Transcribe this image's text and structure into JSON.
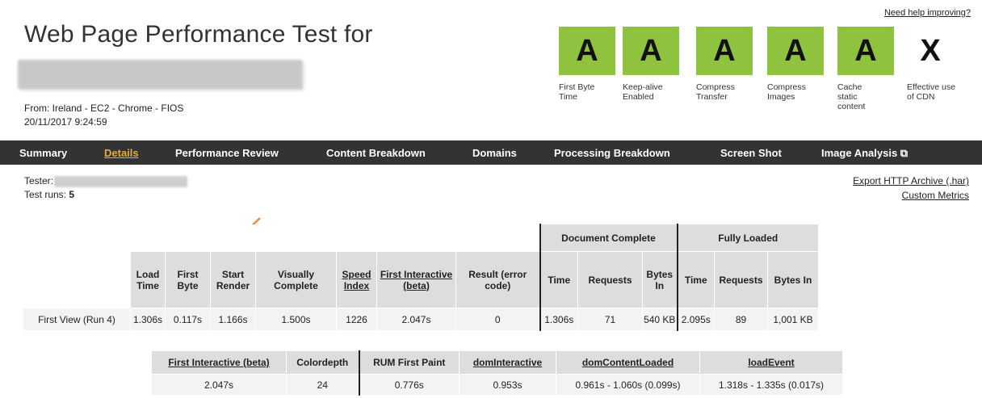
{
  "header": {
    "title": "Web Page Performance Test for",
    "from": "From: Ireland - EC2 - Chrome - FIOS",
    "date": "20/11/2017 9:24:59",
    "help_link": "Need help improving?"
  },
  "grades": [
    {
      "grade": "A",
      "label": "First Byte Time"
    },
    {
      "grade": "A",
      "label": "Keep-alive Enabled"
    },
    {
      "grade": "A",
      "label": "Compress Transfer"
    },
    {
      "grade": "A",
      "label": "Compress Images"
    },
    {
      "grade": "A",
      "label": "Cache static content"
    },
    {
      "grade": "X",
      "label": "Effective use of CDN"
    }
  ],
  "nav": {
    "items": [
      "Summary",
      "Details",
      "Performance Review",
      "Content Breakdown",
      "Domains",
      "Processing Breakdown",
      "Screen Shot",
      "Image Analysis ⧉"
    ],
    "active": "Details"
  },
  "info": {
    "tester_label": "Tester:",
    "runs_label": "Test runs:",
    "runs_value": "5",
    "export_link": "Export HTTP Archive (.har)",
    "custom_metrics_link": "Custom Metrics"
  },
  "results": {
    "group_doc": "Document Complete",
    "group_full": "Fully Loaded",
    "headers": [
      "Load Time",
      "First Byte",
      "Start Render",
      "Visually Complete",
      "Speed Index",
      "First Interactive (beta)",
      "Result (error code)",
      "Time",
      "Requests",
      "Bytes In",
      "Time",
      "Requests",
      "Bytes In"
    ],
    "row_label": "First View (",
    "row_link": "Run 4",
    "row_label_end": ")",
    "row": [
      "1.306s",
      "0.117s",
      "1.166s",
      "1.500s",
      "1226",
      "2.047s",
      "0",
      "1.306s",
      "71",
      "540 KB",
      "2.095s",
      "89",
      "1,001 KB"
    ]
  },
  "metrics": {
    "headers": [
      "First Interactive (beta)",
      "Colordepth",
      "RUM First Paint",
      "domInteractive",
      "domContentLoaded",
      "loadEvent"
    ],
    "row": [
      "2.047s",
      "24",
      "0.776s",
      "0.953s",
      "0.961s - 1.060s (0.099s)",
      "1.318s - 1.335s (0.017s)"
    ]
  },
  "colors": {
    "grade_green": "#8fc33f",
    "nav_bg": "#333333",
    "nav_active": "#e9a93b",
    "arrow": "#e8883a"
  }
}
